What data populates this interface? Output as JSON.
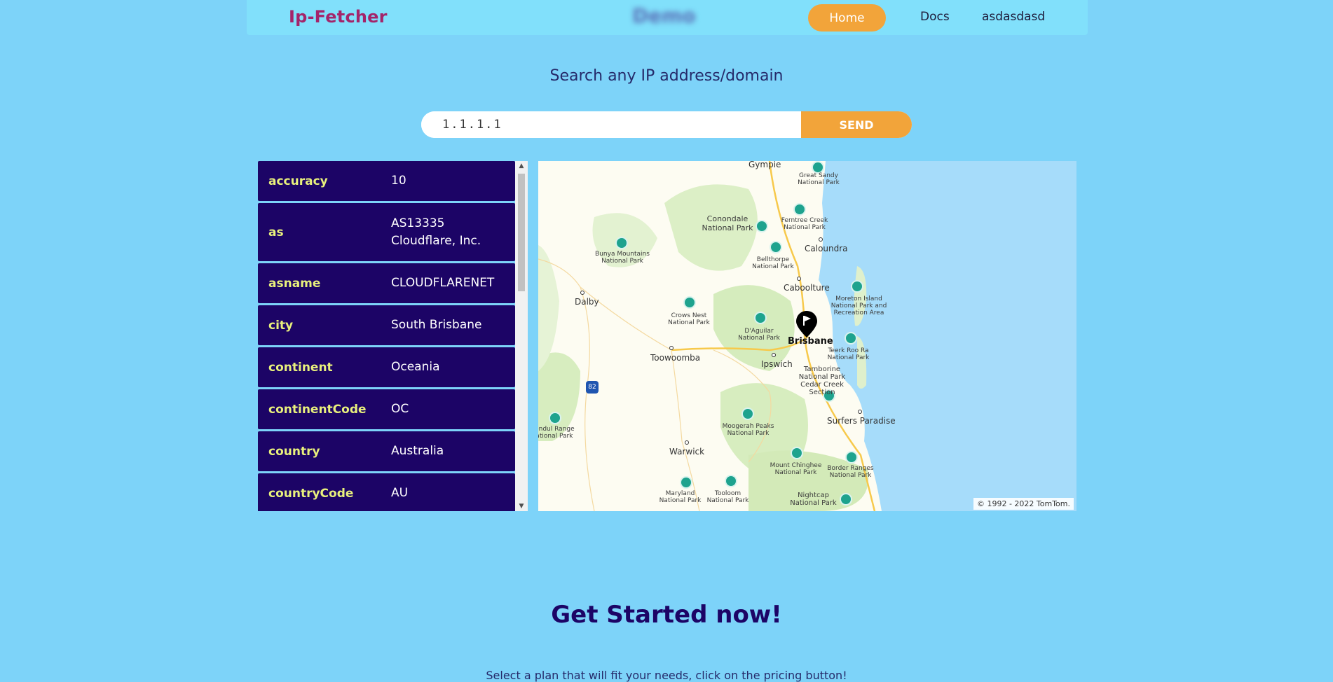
{
  "nav": {
    "brand": "Ip-Fetcher",
    "blurred_title": "Demo",
    "home_label": "Home",
    "docs_label": "Docs",
    "user_label": "asdasdasd"
  },
  "search": {
    "title": "Search any IP address/domain",
    "value": "1.1.1.1",
    "button_label": "SEND"
  },
  "results": [
    {
      "key": "accuracy",
      "value": "10"
    },
    {
      "key": "as",
      "value": "AS13335 Cloudflare, Inc."
    },
    {
      "key": "asname",
      "value": "CLOUDFLARENET"
    },
    {
      "key": "city",
      "value": "South Brisbane"
    },
    {
      "key": "continent",
      "value": "Oceania"
    },
    {
      "key": "continentCode",
      "value": "OC"
    },
    {
      "key": "country",
      "value": "Australia"
    },
    {
      "key": "countryCode",
      "value": "AU"
    }
  ],
  "map": {
    "places": {
      "gympie": "Gympie",
      "great_sandy": "Great Sandy National Park",
      "conondale": "Conondale National Park",
      "ferntree": "Ferntree Creek National Park",
      "caloundra": "Caloundra",
      "bunya": "Bunya Mountains National Park",
      "bellthorpe": "Bellthorpe National Park",
      "caboolture": "Caboolture",
      "dalby": "Dalby",
      "moreton": "Moreton Island National Park and Recreation Area",
      "crows_nest": "Crows Nest National Park",
      "daguilar": "D'Aguilar National Park",
      "brisbane": "Brisbane",
      "toowoomba": "Toowoomba",
      "ipswich": "Ipswich",
      "teerk": "Teerk Roo Ra National Park",
      "tamborine": "Tamborine National Park Cedar Creek Section",
      "highway": "82",
      "surfers": "Surfers Paradise",
      "mondul": "Mondul Range National Park",
      "moogerah": "Moogerah Peaks National Park",
      "warwick": "Warwick",
      "chinghee": "Mount Chinghee National Park",
      "border": "Border Ranges National Park",
      "maryland": "Maryland National Park",
      "tooloom": "Tooloom National Park",
      "nightcap": "Nightcap National Park"
    },
    "copyright": "© 1992 - 2022 TomTom."
  },
  "cta": {
    "title": "Get Started now!",
    "subtitle": "Select a plan that will fit your needs, click on the pricing button!"
  },
  "colors": {
    "background": "#7dd3f9",
    "accent": "#f2a43a",
    "row_bg": "#1c0466",
    "row_key": "#e8f07c",
    "brand": "#a4246a"
  }
}
